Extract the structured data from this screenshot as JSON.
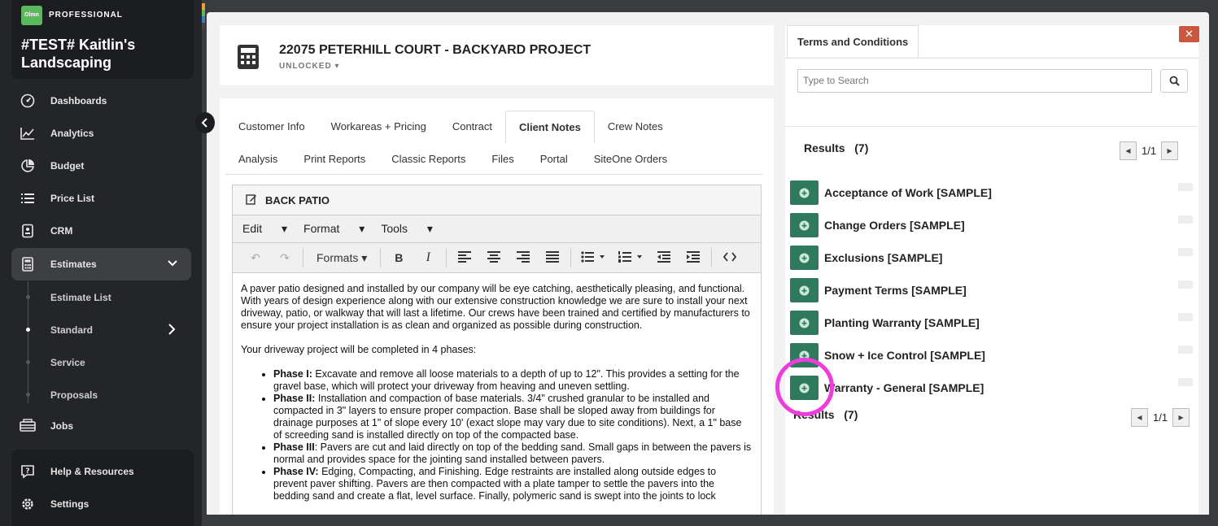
{
  "brand": {
    "logo": "Olmn",
    "tier": "PROFESSIONAL",
    "company": "#TEST# Kaitlin's Landscaping",
    "strip_colors": [
      "#f0a030",
      "#5cb85c",
      "#3a7ac0"
    ]
  },
  "nav": {
    "items": [
      {
        "label": "Dashboards",
        "icon": "gauge-icon"
      },
      {
        "label": "Analytics",
        "icon": "line-chart-icon"
      },
      {
        "label": "Budget",
        "icon": "pie-chart-icon"
      },
      {
        "label": "Price List",
        "icon": "list-icon"
      },
      {
        "label": "CRM",
        "icon": "id-badge-icon"
      },
      {
        "label": "Estimates",
        "icon": "calculator-icon"
      }
    ],
    "sub_items": [
      "Estimate List",
      "Standard",
      "Service",
      "Proposals"
    ],
    "jobs": "Jobs",
    "help": "Help & Resources",
    "settings": "Settings"
  },
  "project": {
    "title": "22075 PETERHILL COURT - BACKYARD PROJECT",
    "status": "UNLOCKED"
  },
  "tabs": {
    "row1": [
      "Customer Info",
      "Workareas + Pricing",
      "Contract",
      "Client Notes",
      "Crew Notes"
    ],
    "row2": [
      "Analysis",
      "Print Reports",
      "Classic Reports",
      "Files",
      "Portal",
      "SiteOne Orders"
    ],
    "active": "Client Notes"
  },
  "editor": {
    "section_title": "BACK PATIO",
    "menus": [
      "Edit",
      "Format",
      "Tools"
    ],
    "formats_label": "Formats",
    "paragraph1": "A paver patio designed and installed by our company will be eye catching, aesthetically pleasing, and functional. With years of design experience along with our extensive construction knowledge we are sure to install your next driveway, patio, or walkway that will last a lifetime.  Our crews have been trained and certified by manufacturers to ensure your project installation is as clean and organized as possible during construction.",
    "paragraph2": "Your driveway project will be completed in 4 phases:",
    "phases": [
      {
        "label": "Phase I:",
        "text": "  Excavate and remove all loose materials to a depth of up to 12\".  This provides a setting for the gravel base, which will protect your driveway from heaving and uneven settling."
      },
      {
        "label": "Phase II:",
        "text": "  Installation and compaction of base materials.  3/4\" crushed granular to be installed and compacted in 3\" layers to ensure proper compaction.  Base shall be sloped away from buildings for drainage purposes at 1\" of slope every 10' (exact slope may vary due to site conditions).  Next, a 1\" base of screeding sand is installed directly on top of the compacted base."
      },
      {
        "label": "Phase III",
        "text": ": Pavers are cut and laid directly on top of the bedding sand.  Small gaps in between the pavers is normal and provides space for the jointing sand installed between pavers."
      },
      {
        "label": "Phase IV:",
        "text": " Edging, Compacting, and Finishing.  Edge restraints are installed along outside edges to prevent paver shifting.  Pavers are then compacted with a plate tamper to settle the pavers into the bedding sand and create a flat, level surface.  Finally, polymeric sand is swept into the joints to lock"
      }
    ]
  },
  "terms": {
    "tab_label": "Terms and Conditions",
    "close": "✕",
    "search_placeholder": "Type to Search",
    "results_label": "Results",
    "results_count": "(7)",
    "page": "1/1",
    "items": [
      "Acceptance of Work [SAMPLE]",
      "Change Orders [SAMPLE]",
      "Exclusions [SAMPLE]",
      "Payment Terms [SAMPLE]",
      "Planting Warranty [SAMPLE]",
      "Snow + Ice Control [SAMPLE]",
      "Warranty - General [SAMPLE]"
    ]
  },
  "colors": {
    "accent_green": "#2f7a5f",
    "highlight": "#ee3ddd",
    "close_red": "#c9583e"
  }
}
